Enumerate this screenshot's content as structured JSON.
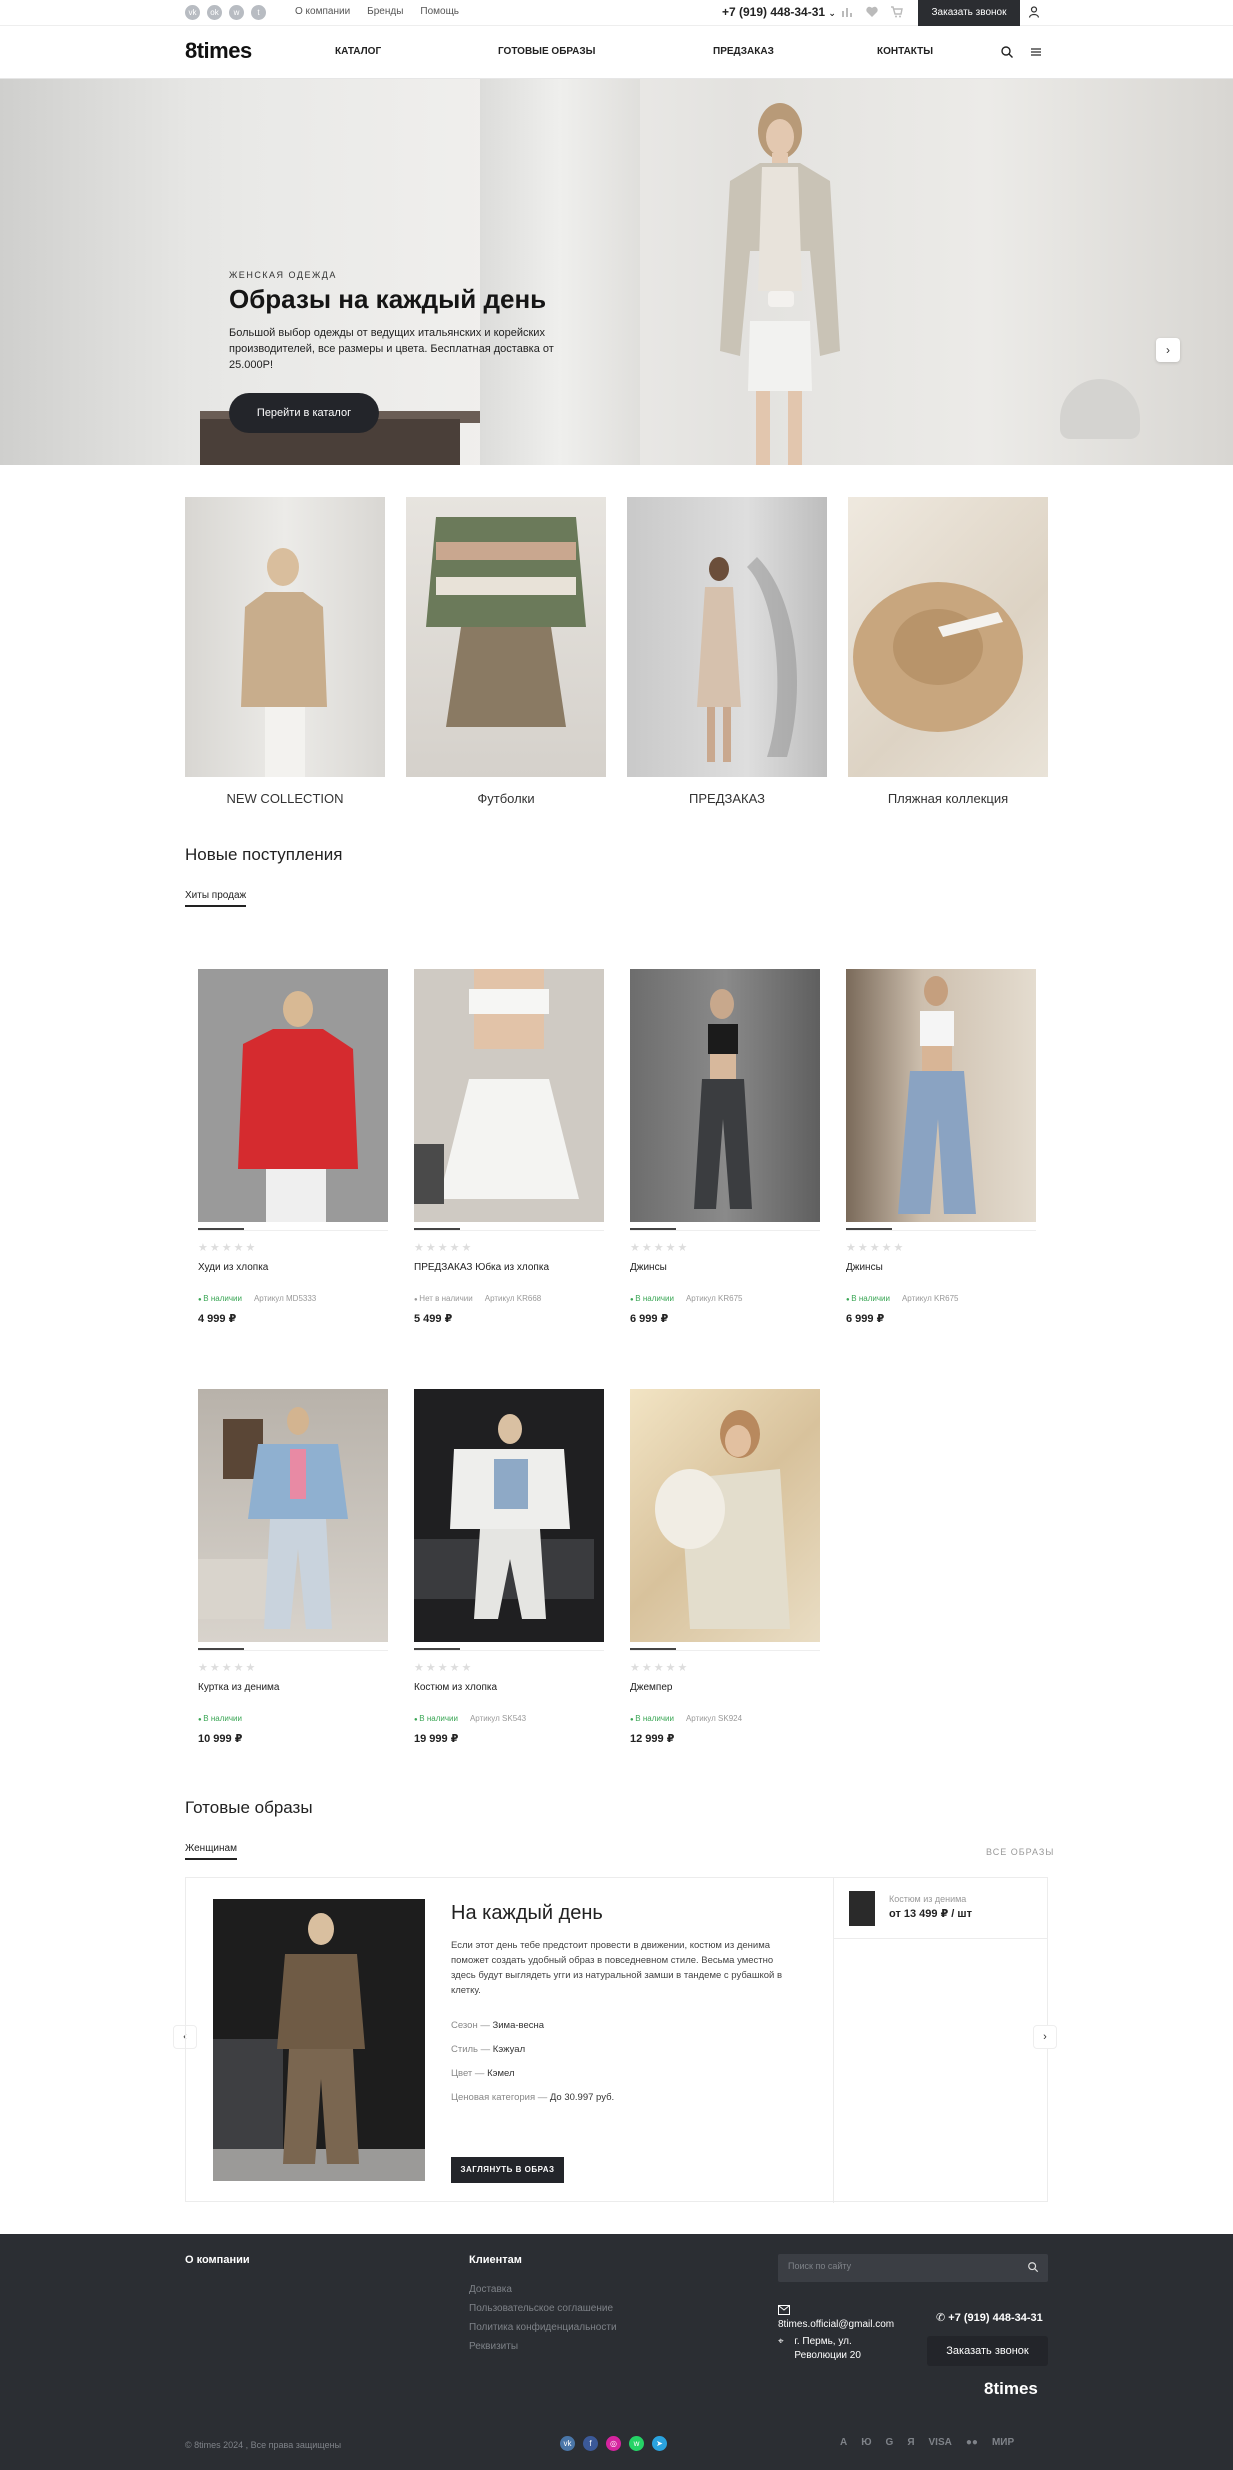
{
  "topbar": {
    "social": [
      "vk-icon",
      "ok-icon",
      "whatsapp-icon",
      "telegram-icon"
    ],
    "links": [
      "О компании",
      "Бренды",
      "Помощь"
    ],
    "phone": "+7 (919) 448-34-31",
    "call_label": "Заказать звонок"
  },
  "header": {
    "logo": "8times",
    "nav": [
      "КАТАЛОГ",
      "ГОТОВЫЕ ОБРАЗЫ",
      "ПРЕДЗАКАЗ",
      "КОНТАКТЫ"
    ]
  },
  "hero": {
    "subtitle": "ЖЕНСКАЯ ОДЕЖДА",
    "title": "Образы на каждый день",
    "text": "Большой выбор одежды от ведущих итальянских и корейских производителей, все размеры и цвета. Бесплатная доставка от 25.000Р!",
    "button": "Перейти в каталог"
  },
  "categories": [
    {
      "label": "NEW COLLECTION"
    },
    {
      "label": "Футболки"
    },
    {
      "label": "ПРЕДЗАКАЗ"
    },
    {
      "label": "Пляжная коллекция"
    }
  ],
  "new_arrivals": {
    "title": "Новые поступления",
    "tab": "Хиты продаж",
    "products": [
      {
        "name": "Худи из хлопка",
        "status": "В наличии",
        "article": "Артикул MD5333",
        "price": "4 999 ₽",
        "in_stock": true
      },
      {
        "name": "ПРЕДЗАКАЗ Юбка из хлопка",
        "status": "Нет в наличии",
        "article": "Артикул KR668",
        "price": "5 499 ₽",
        "in_stock": false
      },
      {
        "name": "Джинсы",
        "status": "В наличии",
        "article": "Артикул KR675",
        "price": "6 999 ₽",
        "in_stock": true
      },
      {
        "name": "Джинсы",
        "status": "В наличии",
        "article": "Артикул KR675",
        "price": "6 999 ₽",
        "in_stock": true
      },
      {
        "name": "Куртка из денима",
        "status": "В наличии",
        "article": "",
        "price": "10 999 ₽",
        "in_stock": true
      },
      {
        "name": "Костюм из хлопка",
        "status": "В наличии",
        "article": "Артикул SK543",
        "price": "19 999 ₽",
        "in_stock": true
      },
      {
        "name": "Джемпер",
        "status": "В наличии",
        "article": "Артикул SK924",
        "price": "12 999 ₽",
        "in_stock": true
      }
    ]
  },
  "outfits": {
    "title": "Готовые образы",
    "tab": "Женщинам",
    "all_label": "ВСЕ ОБРАЗЫ",
    "card": {
      "title": "На каждый день",
      "text": "Если этот день тебе предстоит провести в движении, костюм из денима поможет создать удобный образ в повседневном стиле. Весьма уместно здесь будут выглядеть угги из натуральной замши в тандеме с рубашкой в клетку.",
      "season_k": "Сезон — ",
      "season_v": "Зима-весна",
      "style_k": "Стиль — ",
      "style_v": "Кэжуал",
      "color_k": "Цвет — ",
      "color_v": "Кэмел",
      "price_k": "Ценовая категория — ",
      "price_v": "До 30.997 руб.",
      "button": "ЗАГЛЯНУТЬ В ОБРАЗ"
    },
    "side_item": {
      "name": "Костюм из денима",
      "price": "от 13 499 ₽ / шт"
    }
  },
  "footer": {
    "company": "О компании",
    "clients": "Клиентам",
    "client_links": [
      "Доставка",
      "Пользовательское соглашение",
      "Политика конфиденциальности",
      "Реквизиты"
    ],
    "search_placeholder": "Поиск по сайту",
    "email": "8times.official@gmail.com",
    "address": "г. Пермь, ул. Революции 20",
    "phone": "+7 (919) 448-34-31",
    "call_label": "Заказать звонок",
    "logo": "8times",
    "copyright": "© 8times 2024 , Все права защищены",
    "payments": [
      "А",
      "Ю",
      "G",
      "Я",
      "VISA",
      "●●",
      "МИР"
    ]
  },
  "colors": {
    "dark": "#23252a",
    "footer_bg": "#2b2e33",
    "in_stock": "#3aa655"
  }
}
